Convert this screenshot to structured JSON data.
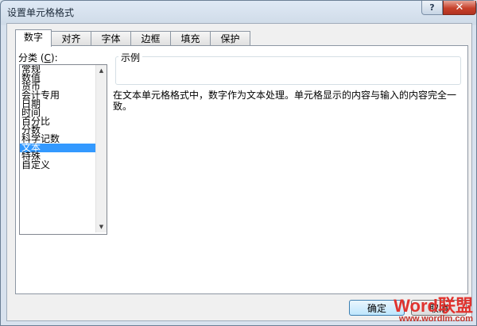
{
  "window": {
    "title": "设置单元格格式",
    "help_label": "?",
    "close_label": "✕"
  },
  "tabs": [
    {
      "label": "数字",
      "active": true
    },
    {
      "label": "对齐"
    },
    {
      "label": "字体"
    },
    {
      "label": "边框"
    },
    {
      "label": "填充"
    },
    {
      "label": "保护"
    }
  ],
  "category": {
    "label_prefix": "分类 (",
    "label_key": "C",
    "label_suffix": "):",
    "items": [
      "常规",
      "数值",
      "货币",
      "会计专用",
      "日期",
      "时间",
      "百分比",
      "分数",
      "科学记数",
      "文本",
      "特殊",
      "自定义"
    ],
    "selected": "文本"
  },
  "sample": {
    "legend": "示例"
  },
  "description": "在文本单元格格式中，数字作为文本处理。单元格显示的内容与输入的内容完全一致。",
  "buttons": {
    "ok": "确定",
    "cancel": "取消"
  },
  "watermark": {
    "logo_part1": "Word",
    "logo_part2": "联盟",
    "url": "www.wordlm.com"
  },
  "colors": {
    "selection": "#3399ff",
    "close_button": "#c7412b"
  }
}
